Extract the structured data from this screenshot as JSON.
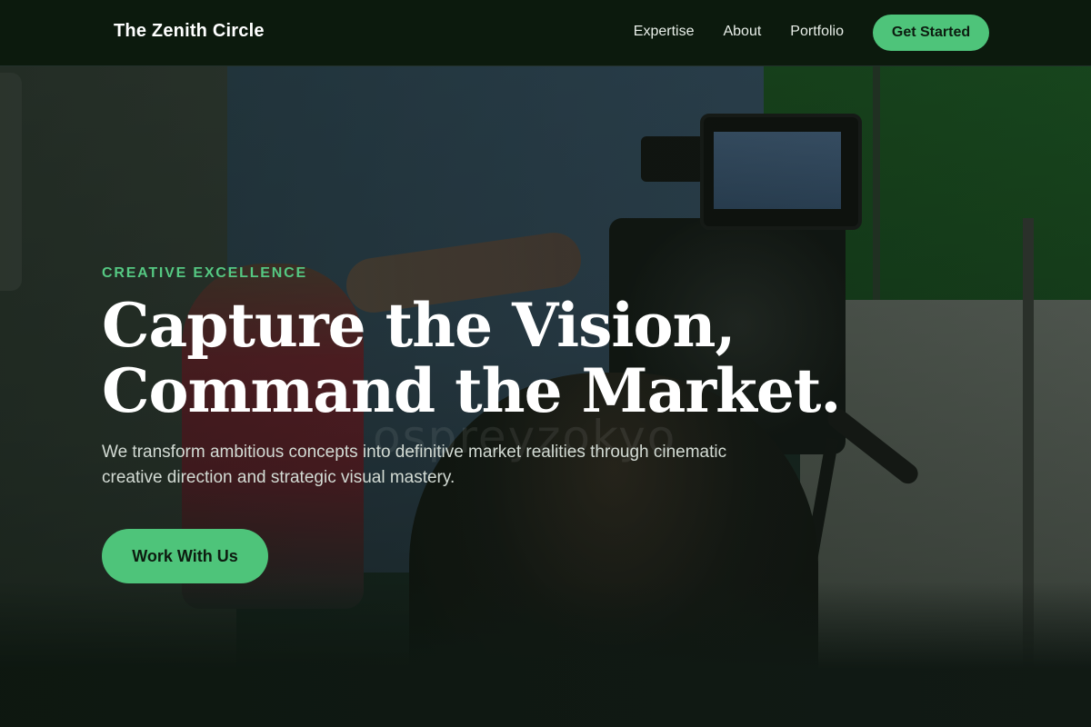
{
  "nav": {
    "brand": "The Zenith Circle",
    "links": [
      "Expertise",
      "About",
      "Portfolio"
    ],
    "cta": "Get Started"
  },
  "hero": {
    "eyebrow": "CREATIVE EXCELLENCE",
    "headline_line1": "Capture the Vision,",
    "headline_line2": "Command the Market.",
    "subtext": "We transform ambitious concepts into definitive market realities through cinematic creative direction and strategic visual mastery.",
    "button": "Work With Us",
    "background_watermark": "ospreyzokyo"
  },
  "colors": {
    "accent": "#4ec47a",
    "navbar": "#0c1a0d",
    "eyebrow": "#55c882"
  }
}
